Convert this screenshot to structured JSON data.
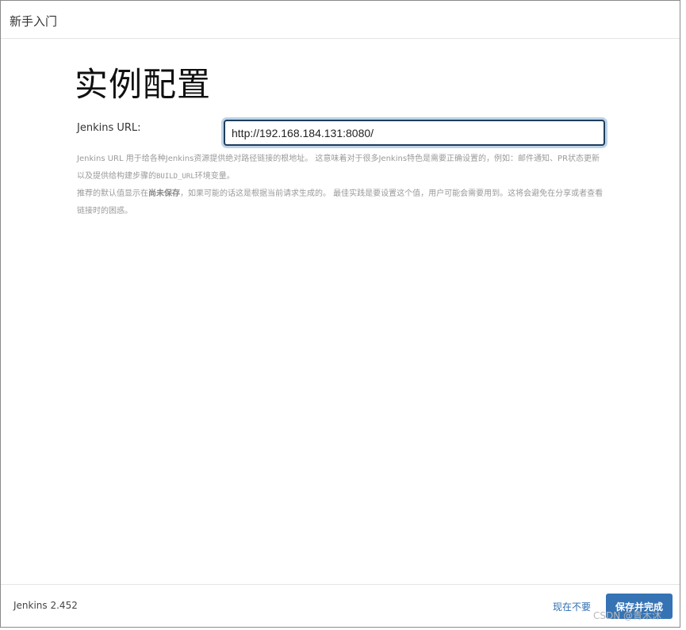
{
  "header": {
    "title": "新手入门"
  },
  "page": {
    "title": "实例配置"
  },
  "form": {
    "url_label": "Jenkins URL:",
    "url_value": "http://192.168.184.131:8080/"
  },
  "help": {
    "line1_text": "Jenkins URL 用于给各种Jenkins资源提供绝对路径链接的根地址。 这意味着对于很多Jenkins特色是需要正确设置的，例如：邮件通知、PR状态更新以及提供给构建步骤的",
    "line1_code": "BUILD_URL",
    "line1_tail": "环境变量。",
    "line2_pre": "推荐的默认值显示在",
    "line2_bold": "尚未保存",
    "line2_post": "，如果可能的话这是根据当前请求生成的。 最佳实践是要设置这个值，用户可能会需要用到。这将会避免在分享或者查看链接时的困惑。"
  },
  "footer": {
    "version": "Jenkins 2.452",
    "skip_label": "现在不要",
    "finish_label": "保存并完成"
  },
  "watermark": "CSDN @青木沐"
}
